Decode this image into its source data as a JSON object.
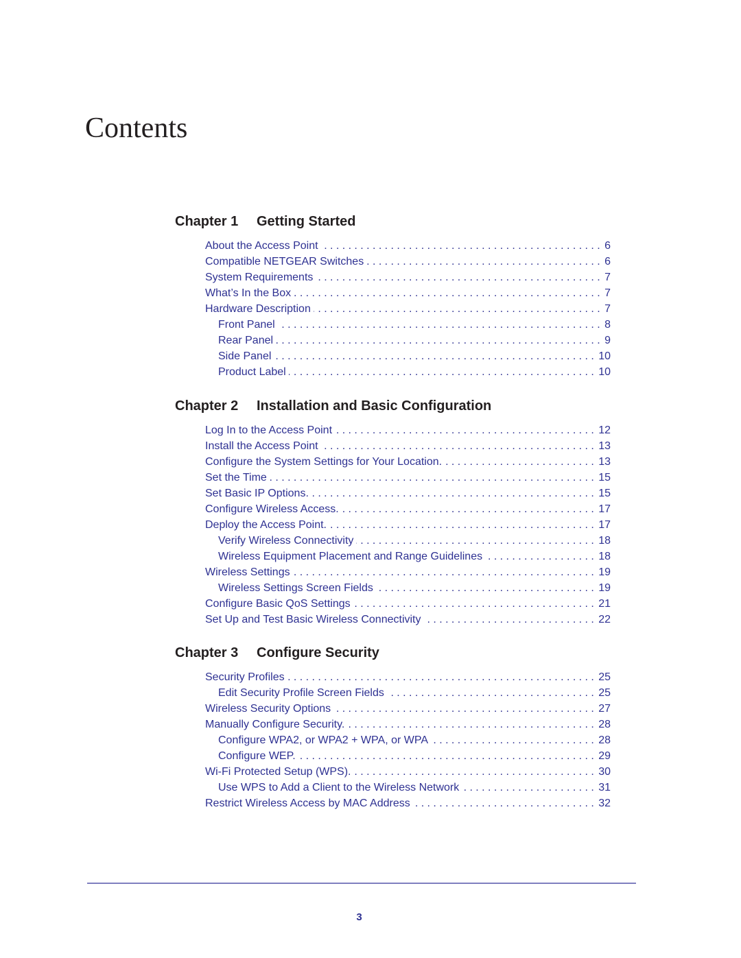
{
  "page_title": "Contents",
  "colors": {
    "heading": "#231f20",
    "link": "#2e3192",
    "rule": "#7f7fbf"
  },
  "chapters": [
    {
      "number_label": "Chapter 1",
      "title": "Getting Started",
      "entries": [
        {
          "title": "About the Access Point",
          "page": "6",
          "level": 1
        },
        {
          "title": "Compatible NETGEAR Switches",
          "page": "6",
          "level": 1
        },
        {
          "title": "System Requirements",
          "page": "7",
          "level": 1
        },
        {
          "title": "What’s In the Box",
          "page": "7",
          "level": 1
        },
        {
          "title": "Hardware Description",
          "page": "7",
          "level": 1
        },
        {
          "title": "Front Panel",
          "page": "8",
          "level": 2
        },
        {
          "title": "Rear Panel",
          "page": "9",
          "level": 2
        },
        {
          "title": "Side Panel",
          "page": "10",
          "level": 2
        },
        {
          "title": "Product Label",
          "page": "10",
          "level": 2
        }
      ]
    },
    {
      "number_label": "Chapter 2",
      "title": "Installation and Basic Configuration",
      "entries": [
        {
          "title": "Log In to the Access Point",
          "page": "12",
          "level": 1
        },
        {
          "title": "Install the Access Point",
          "page": "13",
          "level": 1
        },
        {
          "title": "Configure the System Settings for Your Location.",
          "page": "13",
          "level": 1
        },
        {
          "title": "Set the Time",
          "page": "15",
          "level": 1
        },
        {
          "title": "Set Basic IP Options.",
          "page": "15",
          "level": 1
        },
        {
          "title": "Configure Wireless Access.",
          "page": "17",
          "level": 1
        },
        {
          "title": "Deploy the Access Point.",
          "page": "17",
          "level": 1
        },
        {
          "title": "Verify Wireless Connectivity",
          "page": "18",
          "level": 2
        },
        {
          "title": "Wireless Equipment Placement and Range Guidelines",
          "page": "18",
          "level": 2
        },
        {
          "title": "Wireless Settings",
          "page": "19",
          "level": 1
        },
        {
          "title": "Wireless Settings Screen Fields",
          "page": "19",
          "level": 2
        },
        {
          "title": "Configure Basic QoS Settings",
          "page": "21",
          "level": 1
        },
        {
          "title": "Set Up and Test Basic Wireless Connectivity",
          "page": "22",
          "level": 1
        }
      ]
    },
    {
      "number_label": "Chapter 3",
      "title": "Configure Security",
      "entries": [
        {
          "title": "Security Profiles",
          "page": "25",
          "level": 1
        },
        {
          "title": "Edit Security Profile Screen Fields",
          "page": "25",
          "level": 2
        },
        {
          "title": "Wireless Security Options",
          "page": "27",
          "level": 1
        },
        {
          "title": "Manually Configure Security.",
          "page": "28",
          "level": 1
        },
        {
          "title": "Configure WPA2, or WPA2 + WPA, or WPA",
          "page": "28",
          "level": 2
        },
        {
          "title": "Configure WEP.",
          "page": "29",
          "level": 2
        },
        {
          "title": "Wi-Fi Protected Setup (WPS).",
          "page": "30",
          "level": 1
        },
        {
          "title": "Use WPS to Add a Client to the Wireless Network",
          "page": "31",
          "level": 2
        },
        {
          "title": "Restrict Wireless Access by MAC Address",
          "page": "32",
          "level": 1
        }
      ]
    }
  ],
  "footer": {
    "page_number": "3"
  }
}
